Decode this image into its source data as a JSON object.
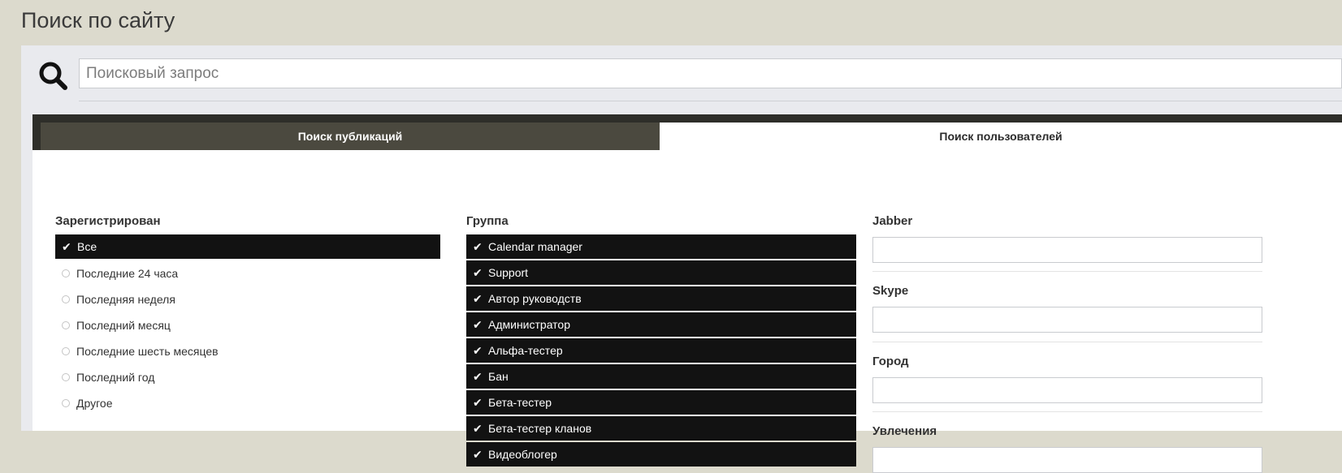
{
  "page": {
    "title": "Поиск по сайту"
  },
  "search": {
    "placeholder": "Поисковый запрос",
    "value": ""
  },
  "tabs": [
    {
      "label": "Поиск публикаций",
      "active": false
    },
    {
      "label": "Поиск пользователей",
      "active": true
    }
  ],
  "registered": {
    "title": "Зарегистрирован",
    "options": [
      {
        "label": "Все",
        "selected": true
      },
      {
        "label": "Последние 24 часа",
        "selected": false
      },
      {
        "label": "Последняя неделя",
        "selected": false
      },
      {
        "label": "Последний месяц",
        "selected": false
      },
      {
        "label": "Последние шесть месяцев",
        "selected": false
      },
      {
        "label": "Последний год",
        "selected": false
      },
      {
        "label": "Другое",
        "selected": false
      }
    ]
  },
  "group": {
    "title": "Группа",
    "items": [
      {
        "label": "Calendar manager",
        "checked": true
      },
      {
        "label": "Support",
        "checked": true
      },
      {
        "label": "Автор руководств",
        "checked": true
      },
      {
        "label": "Администратор",
        "checked": true
      },
      {
        "label": "Альфа-тестер",
        "checked": true
      },
      {
        "label": "Бан",
        "checked": true
      },
      {
        "label": "Бета-тестер",
        "checked": true
      },
      {
        "label": "Бета-тестер кланов",
        "checked": true
      },
      {
        "label": "Видеоблогер",
        "checked": true
      }
    ]
  },
  "fields": [
    {
      "label": "Jabber",
      "value": ""
    },
    {
      "label": "Skype",
      "value": ""
    },
    {
      "label": "Город",
      "value": ""
    },
    {
      "label": "Увлечения",
      "value": ""
    }
  ],
  "colors": {
    "page_bg": "#dcdacd",
    "panel_bg": "#e9eaee",
    "tabs_bar": "#2e2e29",
    "tab_inactive": "#4b493f",
    "selected_row": "#121212"
  },
  "icons": {
    "search": "search-icon",
    "check": "check-icon",
    "radio": "radio-icon"
  }
}
